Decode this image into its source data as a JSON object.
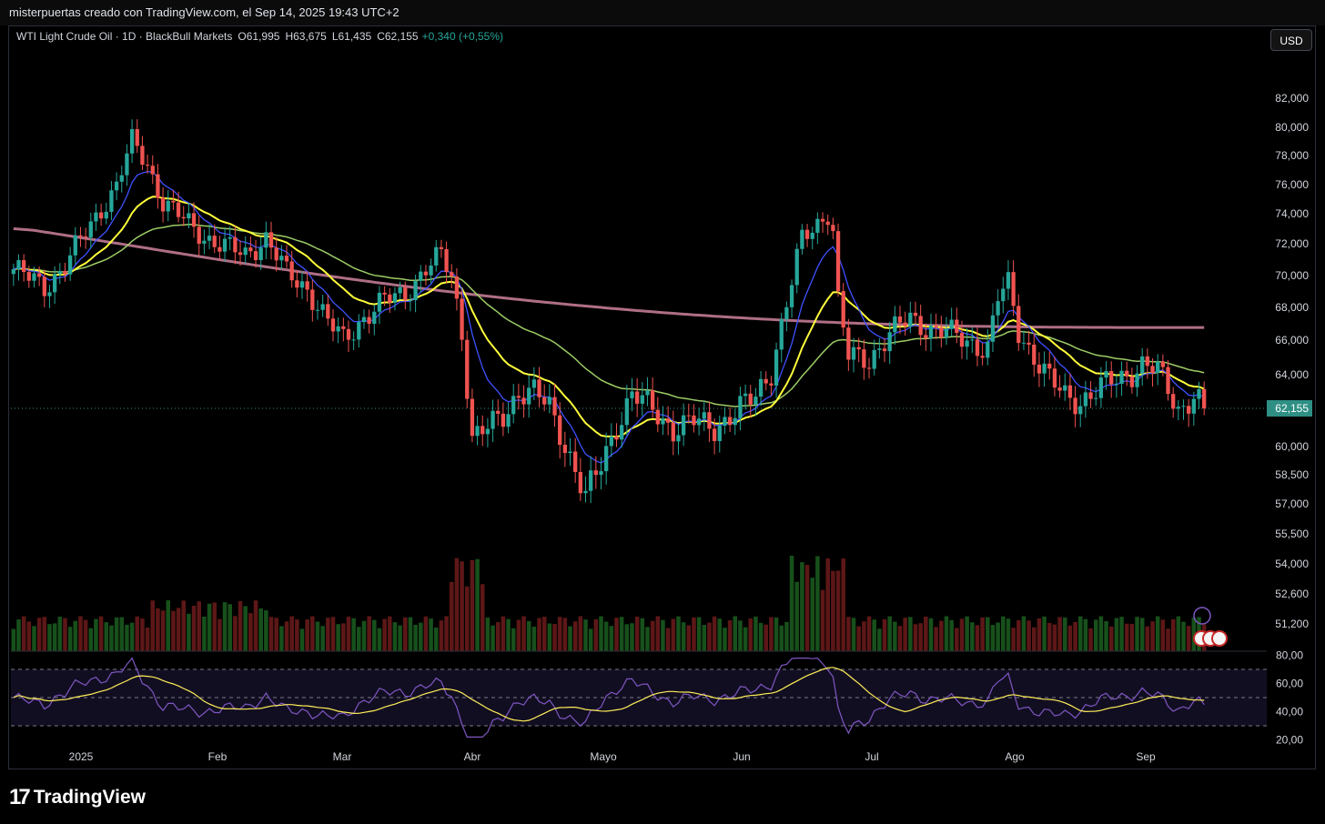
{
  "header": {
    "attribution": "misterpuertas creado con TradingView.com, el Sep 14, 2025 19:43 UTC+2"
  },
  "legend": {
    "symbol": "WTI Light Crude Oil · 1D · BlackBull Markets",
    "open": "O61,995",
    "high": "H63,675",
    "low": "L61,435",
    "close": "C62,155",
    "change": "+0,340 (+0,55%)"
  },
  "currency_button": "USD",
  "footer": {
    "brand": "TradingView"
  },
  "colors": {
    "up": "#26a69a",
    "down": "#ef5350",
    "ema_fast": "#3f51ff",
    "ema_mid": "#ffff3b",
    "ema_slow": "#9ccc65",
    "sma_long": "#c27b95",
    "rsi": "#7e57c2",
    "rsi_ma": "#ffee58",
    "last_price_bg": "#2e8f84"
  },
  "chart_data": [
    {
      "type": "candlestick",
      "title": "WTI Light Crude Oil",
      "x_tick_labels": [
        "2025",
        "Feb",
        "Mar",
        "Abr",
        "Mayo",
        "Jun",
        "Jul",
        "Ago",
        "Sep"
      ],
      "y_tick_labels": [
        "82,000",
        "80,000",
        "78,000",
        "76,000",
        "74,000",
        "72,000",
        "70,000",
        "68,000",
        "66,000",
        "64,000",
        "60,000",
        "58,500",
        "57,000",
        "55,500",
        "54,000",
        "52,600",
        "51,200"
      ],
      "y_tick_values": [
        82,
        80,
        78,
        76,
        74,
        72,
        70,
        68,
        66,
        64,
        60,
        58.5,
        57,
        55.5,
        54,
        52.6,
        51.2
      ],
      "last_price": 62.155,
      "last_price_label": "62,155",
      "ohlc_anchors": [
        [
          0,
          70.4
        ],
        [
          6,
          69.3
        ],
        [
          10,
          70.6
        ],
        [
          15,
          73.3
        ],
        [
          20,
          75.9
        ],
        [
          23,
          79.0
        ],
        [
          26,
          77.4
        ],
        [
          29,
          74.8
        ],
        [
          33,
          73.6
        ],
        [
          37,
          72.5
        ],
        [
          41,
          71.8
        ],
        [
          45,
          71.3
        ],
        [
          49,
          72.4
        ],
        [
          53,
          70.1
        ],
        [
          57,
          69.2
        ],
        [
          61,
          67.1
        ],
        [
          64,
          66.0
        ],
        [
          68,
          67.4
        ],
        [
          72,
          68.4
        ],
        [
          76,
          68.9
        ],
        [
          80,
          70.4
        ],
        [
          83,
          71.2
        ],
        [
          85,
          70.0
        ],
        [
          87,
          66.5
        ],
        [
          89,
          60.5
        ],
        [
          92,
          61.0
        ],
        [
          95,
          61.7
        ],
        [
          98,
          63.1
        ],
        [
          101,
          63.0
        ],
        [
          104,
          62.2
        ],
        [
          108,
          59.5
        ],
        [
          111,
          57.3
        ],
        [
          114,
          59.0
        ],
        [
          117,
          61.2
        ],
        [
          120,
          62.9
        ],
        [
          124,
          62.1
        ],
        [
          128,
          61.0
        ],
        [
          132,
          61.4
        ],
        [
          136,
          61.1
        ],
        [
          140,
          61.9
        ],
        [
          144,
          62.8
        ],
        [
          147,
          64.3
        ],
        [
          150,
          68.2
        ],
        [
          153,
          72.3
        ],
        [
          156,
          73.4
        ],
        [
          158,
          74.1
        ],
        [
          159,
          72.9
        ],
        [
          160,
          68.4
        ],
        [
          162,
          65.0
        ],
        [
          166,
          64.9
        ],
        [
          170,
          66.4
        ],
        [
          174,
          67.3
        ],
        [
          177,
          66.8
        ],
        [
          181,
          66.5
        ],
        [
          185,
          65.9
        ],
        [
          189,
          65.6
        ],
        [
          191,
          68.6
        ],
        [
          193,
          69.4
        ],
        [
          195,
          66.5
        ],
        [
          198,
          65.1
        ],
        [
          201,
          63.7
        ],
        [
          204,
          62.8
        ],
        [
          207,
          62.6
        ],
        [
          210,
          63.1
        ],
        [
          213,
          63.6
        ],
        [
          216,
          64.0
        ],
        [
          219,
          64.6
        ],
        [
          222,
          64.2
        ],
        [
          224,
          63.2
        ],
        [
          226,
          62.1
        ],
        [
          229,
          62.9
        ],
        [
          231,
          62.155
        ]
      ],
      "volume_range": "scaled 0–1 per bar (relative)",
      "rsi": {
        "levels": [
          70,
          50,
          30
        ],
        "y_tick_labels": [
          "80,00",
          "60,00",
          "40,00",
          "20,00"
        ],
        "y_tick_values": [
          80,
          60,
          40,
          20
        ]
      }
    }
  ]
}
